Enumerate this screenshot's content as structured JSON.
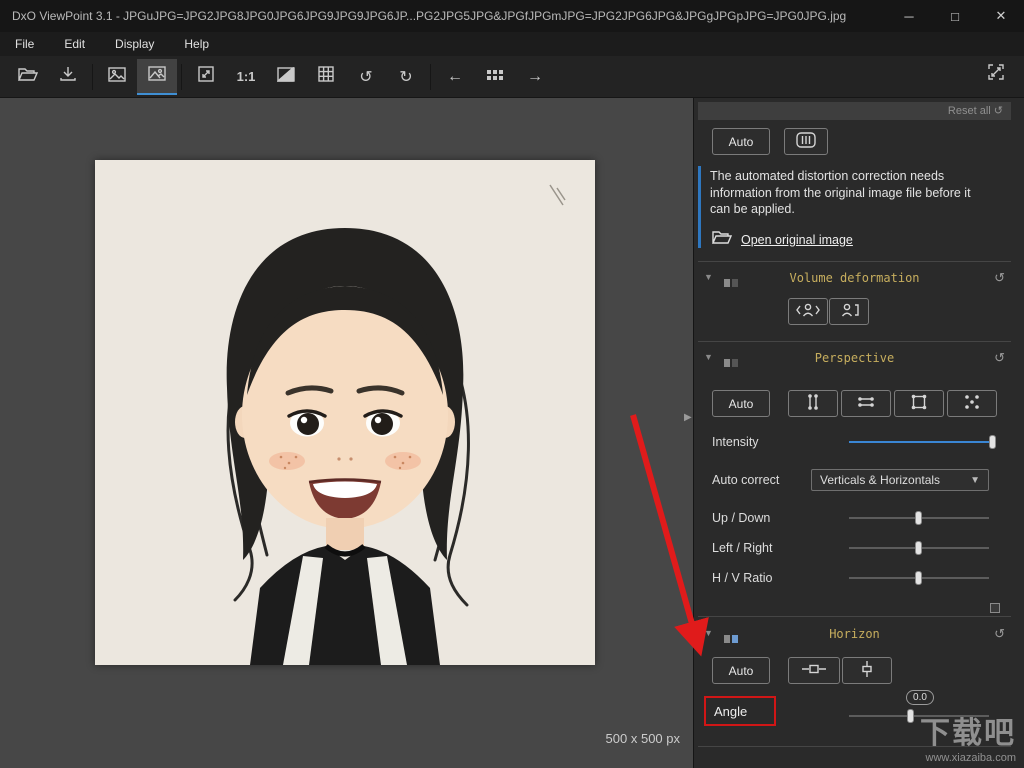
{
  "window": {
    "title": "DxO ViewPoint 3.1 - JPGuJPG=JPG2JPG8JPG0JPG6JPG9JPG9JPG6JP...PG2JPG5JPG&JPGfJPGmJPG=JPG2JPG6JPG&JPGgJPGpJPG=JPG0JPG.jpg",
    "minimize_glyph": "─",
    "maximize_glyph": "□",
    "close_glyph": "✕"
  },
  "menu": {
    "items": [
      {
        "label": "File"
      },
      {
        "label": "Edit"
      },
      {
        "label": "Display"
      },
      {
        "label": "Help"
      }
    ]
  },
  "toolbar": {
    "zoom_ratio_label": "1:1",
    "icon_names": [
      "open-folder",
      "export",
      "thumbnail-image",
      "image-view",
      "fit-view",
      "zoom-1-1",
      "compare",
      "grid",
      "rotate-left",
      "rotate-right",
      "previous",
      "contact-sheet",
      "next",
      "fullscreen"
    ]
  },
  "canvas": {
    "size_label": "500 x 500 px"
  },
  "panel": {
    "reset_all_label": "Reset all ↺",
    "top": {
      "auto_label": "Auto"
    },
    "notice": {
      "text": "The automated distortion correction needs information from the original image file before it can be applied.",
      "link_label": "Open original image"
    },
    "volume": {
      "title": "Volume deformation"
    },
    "perspective": {
      "title": "Perspective",
      "auto_label": "Auto",
      "intensity_label": "Intensity",
      "auto_correct_label": "Auto correct",
      "auto_correct_value": "Verticals & Horizontals",
      "up_down_label": "Up / Down",
      "left_right_label": "Left / Right",
      "hv_ratio_label": "H / V Ratio"
    },
    "horizon": {
      "title": "Horizon",
      "auto_label": "Auto",
      "angle_label": "Angle",
      "angle_value": "0.0"
    }
  },
  "watermark": {
    "title": "下载吧",
    "url": "www.xiazaiba.com"
  },
  "colors": {
    "accent_blue": "#3a86d4",
    "section_title": "#c7ae5e",
    "highlight_red": "#d01616"
  }
}
